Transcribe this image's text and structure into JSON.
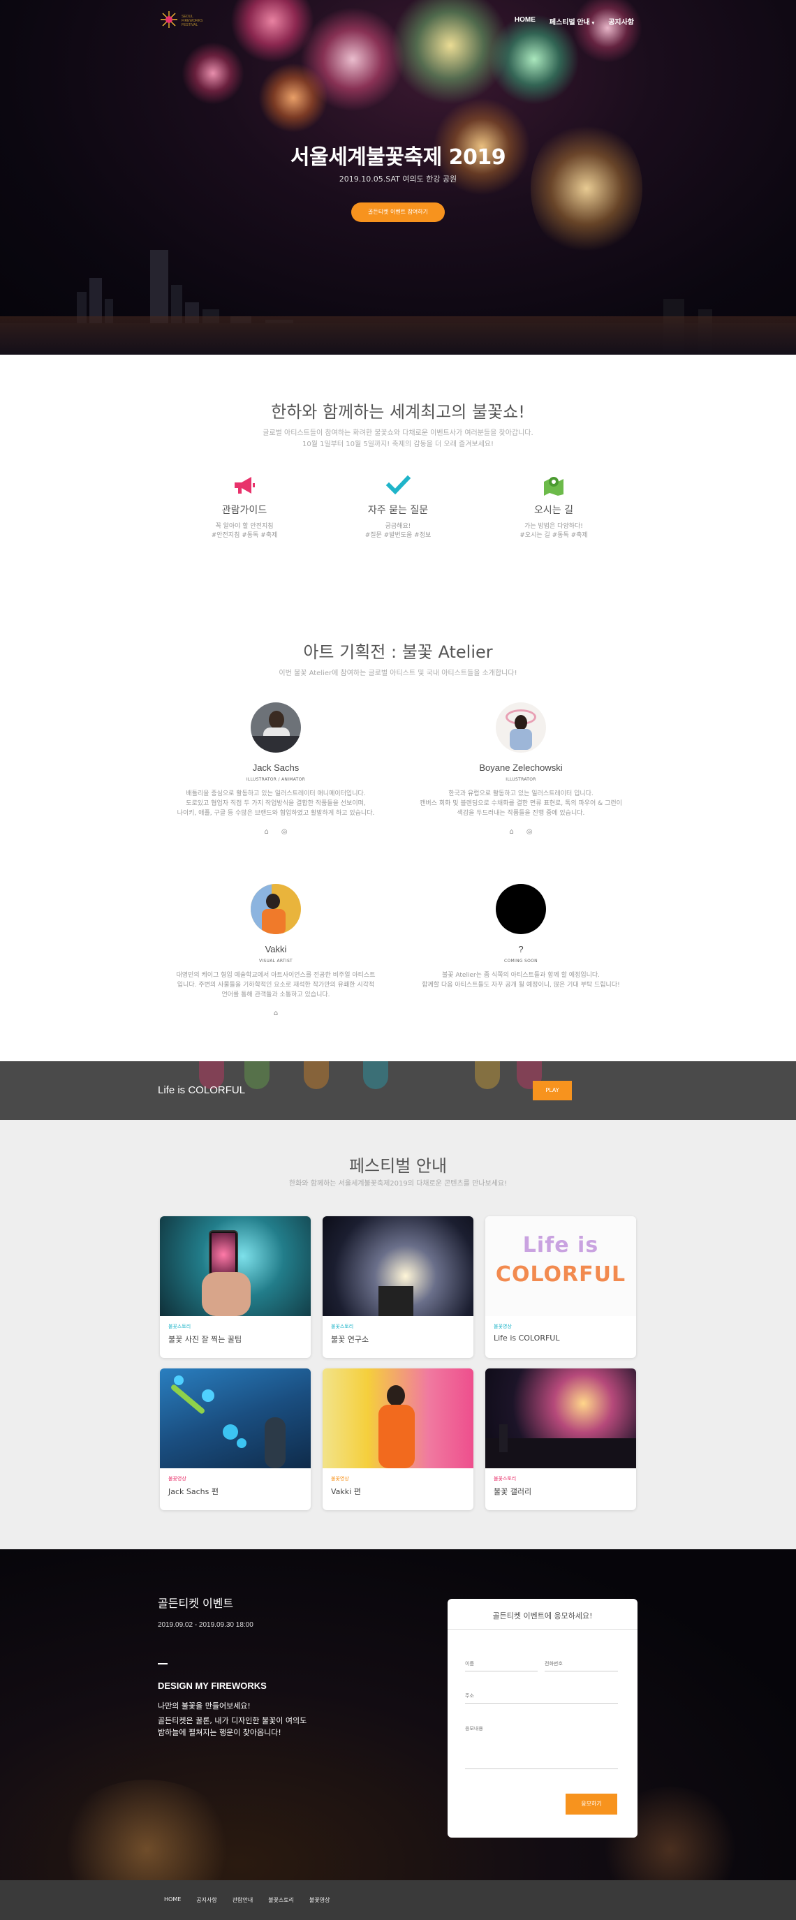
{
  "nav": {
    "logo_text": "SEOUL FIREWORKS FESTIVAL",
    "items": [
      {
        "label": "HOME"
      },
      {
        "label": "페스티벌 안내"
      },
      {
        "label": "공지사항"
      }
    ]
  },
  "hero": {
    "title": "서울세계불꽃축제 2019",
    "subtitle": "2019.10.05.SAT 여의도 한강 공원",
    "button": "골든티켓 이벤트 참여하기"
  },
  "intro": {
    "title": "한하와 함께하는 세계최고의 불꽃쇼!",
    "desc1": "글로벌 아티스트들이 참여하는 화려한 불꽃쇼와 다채로운 이벤트사가 여러분들을 찾아갑니다.",
    "desc2": "10월 1일부터 10월 5일까지! 축제의 감동을 더 오래 즐겨보세요!",
    "features": [
      {
        "icon": "megaphone-icon",
        "color": "#e8326b",
        "title": "관람가이드",
        "desc1": "꼭 알아야 할 안전지침",
        "desc2": "#안전지침 #동독 #축제"
      },
      {
        "icon": "check-icon",
        "color": "#1fb4c9",
        "title": "자주 묻는 질문",
        "desc1": "궁금해요!",
        "desc2": "#질문 #발번도움 #정보"
      },
      {
        "icon": "map-pin-icon",
        "color": "#6cba4a",
        "title": "오시는 길",
        "desc1": "가는 방법은 다양하다!",
        "desc2": "#오시는 길 #동독 #축제"
      }
    ]
  },
  "atelier": {
    "title": "아트 기획전 : 불꽃 Atelier",
    "desc": "이번 불꽃 Atelier에 참여하는 글로벌 아티스트 및 국내 아티스트들을 소개합니다!",
    "artists": [
      {
        "name": "Jack Sachs",
        "role": "ILLUSTRATOR / ANIMATOR",
        "desc": [
          "배틀리을 중심으로 활동하고 있는 일러스트레이터 애니메이터입니다.",
          "도로있고 협업자 직접 두 가지 작업방식을 결합한 작품들을 선보이며,",
          "나이키, 애플, 구글 등 수많은 브랜드와 협업하였고 활발하게 하고 있습니다."
        ],
        "socials": [
          "home-icon",
          "instagram-icon"
        ]
      },
      {
        "name": "Boyane Zelechowski",
        "role": "ILLUSTRATOR",
        "desc": [
          "한국과 유럽으로 활동하고 있는 일러스트레이터 입니다.",
          "캔버스 회화 및 블렌딩으로 수채화를 결한 면류 표현로, 톡의 파우어 & 그런이",
          "색감을 두드러내는 작품들을 진행 중에 있습니다."
        ],
        "socials": [
          "home-icon",
          "instagram-icon"
        ]
      },
      {
        "name": "Vakki",
        "role": "VISUAL ARTIST",
        "desc": [
          "대영민의 케이그 형입 예술학교에서 아트사이언스를 전공한 비주얼 아티스트",
          "입니다. 주변의 사물들을 기하학적인 요소로 재석한 작가만의 유쾌한 시각적",
          "언어를 통해 관객들과 소통하고 있습니다."
        ],
        "socials": [
          "home-icon"
        ]
      },
      {
        "name": "?",
        "role": "COMING SOON",
        "desc": [
          "불꽃 Atelier는 좀 식쪽의 아티스트들과 함께 할 예정입니다.",
          "함께할 다음 아티스트들도 자꾸 공개 될 예정이니, 많은 기대 부탁 드립니다!"
        ],
        "socials": []
      }
    ]
  },
  "banner": {
    "text": "Life is COLORFUL",
    "button": "PLAY"
  },
  "festival": {
    "title": "페스티벌 안내",
    "desc": "한화와 함께하는 서울세계불꽃축제2019의 다채로운 콘텐츠를 만나보세요!",
    "cards": [
      {
        "category": "불꽃스토리",
        "cat_color": "#1fb4c9",
        "title": "불꽃 사진 잘 찍는 꿀팁"
      },
      {
        "category": "불꽃스토리",
        "cat_color": "#1fb4c9",
        "title": "불꽃 연구소"
      },
      {
        "category": "불꽃영상",
        "cat_color": "#1fb4c9",
        "title": "Life is COLORFUL"
      },
      {
        "category": "불꽃영상",
        "cat_color": "#e8326b",
        "title": "Jack Sachs 편"
      },
      {
        "category": "불꽃영상",
        "cat_color": "#f7931e",
        "title": "Vakki 편"
      },
      {
        "category": "불꽃스토리",
        "cat_color": "#e8326b",
        "title": "불꽃 갤러리"
      }
    ],
    "card3_text_line1": "Life is",
    "card3_text_line2": "COLORFUL"
  },
  "event": {
    "title": "골든티켓 이벤트",
    "date": "2019.09.02 - 2019.09.30 18:00",
    "design": "DESIGN MY FIREWORKS",
    "p1": "나만의 불꽃을 만들어보세요!",
    "p2": "골든티켓은 꿀론, 내가 디자인한 불꽃이 여의도 밤하늘에 펼쳐지는 행운이 찾아옵니다!",
    "form": {
      "heading": "골든티켓 이벤트에 응모하세요!",
      "name": "이름",
      "phone": "전화번호",
      "address": "주소",
      "message": "응모내용",
      "submit": "응모하기"
    }
  },
  "footer": {
    "links": [
      {
        "label": "HOME"
      },
      {
        "label": "공지사항"
      },
      {
        "label": "관람안내"
      },
      {
        "label": "불꽃스토리"
      },
      {
        "label": "불꽃영상"
      }
    ]
  }
}
